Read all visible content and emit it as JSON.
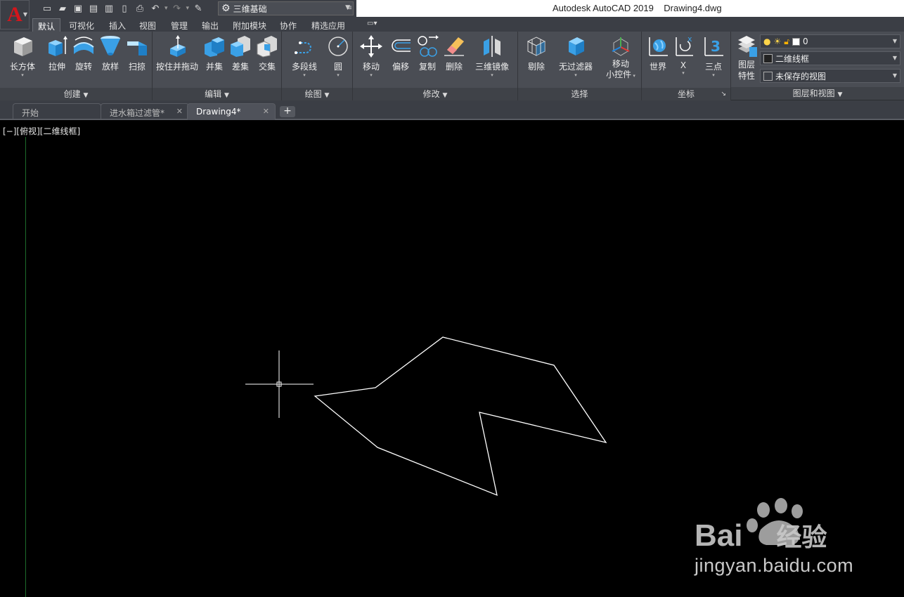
{
  "app": {
    "logo_letter": "A",
    "title": "Autodesk AutoCAD 2019",
    "document": "Drawing4.dwg",
    "workspace": "三维基础"
  },
  "ribbon_tabs": [
    "默认",
    "可视化",
    "插入",
    "视图",
    "管理",
    "输出",
    "附加模块",
    "协作",
    "精选应用"
  ],
  "ribbon": {
    "create": {
      "title": "创建",
      "tools": [
        "长方体",
        "拉伸",
        "旋转",
        "放样",
        "扫掠"
      ]
    },
    "edit": {
      "title": "编辑",
      "tools": [
        "按住并拖动",
        "并集",
        "差集",
        "交集"
      ]
    },
    "draw": {
      "title": "绘图",
      "tools": [
        "多段线",
        "圆"
      ]
    },
    "modify": {
      "title": "修改",
      "tools": [
        "移动",
        "偏移",
        "复制",
        "删除",
        "三维镜像"
      ]
    },
    "select": {
      "title": "选择",
      "tools": [
        "剔除",
        "无过滤器",
        "移动",
        "小控件"
      ]
    },
    "coords": {
      "title": "坐标",
      "tools": [
        "世界",
        "X",
        "三点"
      ]
    },
    "layers": {
      "title": "图层和视图",
      "tool": "图层",
      "tool2": "特性",
      "layer_value": "0",
      "visual_style": "二维线框",
      "view": "未保存的视图"
    }
  },
  "doc_tabs": [
    "开始",
    "进水箱过滤管*",
    "Drawing4*"
  ],
  "viewport_label": "[−][俯视][二维线框]",
  "colors": {
    "chrome_dark": "#3b3e45",
    "ribbon_bg": "#4a4d54",
    "canvas_bg": "#000000",
    "polyline": "#ffffff",
    "ucs_y_axis": "#1d6b2a",
    "logo_red": "#d4161c"
  },
  "watermark": {
    "brand": "Bai",
    "brand_tail": "经验",
    "url": "jingyan.baidu.com"
  }
}
